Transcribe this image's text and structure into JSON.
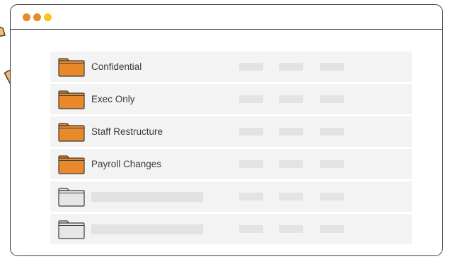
{
  "window": {
    "controls": [
      {
        "name": "close",
        "color": "#e8892b"
      },
      {
        "name": "minimize",
        "color": "#e8892b"
      },
      {
        "name": "maximize",
        "color": "#f5c518"
      }
    ]
  },
  "folders": [
    {
      "label": "Confidential",
      "color": "#e8892b"
    },
    {
      "label": "Exec Only",
      "color": "#e8892b"
    },
    {
      "label": "Staff Restructure",
      "color": "#e8892b"
    },
    {
      "label": "Payroll Changes",
      "color": "#e8892b"
    },
    {
      "label": "",
      "color": "#e6e6e6"
    },
    {
      "label": "",
      "color": "#e6e6e6"
    }
  ],
  "dragged_item": {
    "icon": "document-icon",
    "color": "#f8b76a"
  }
}
